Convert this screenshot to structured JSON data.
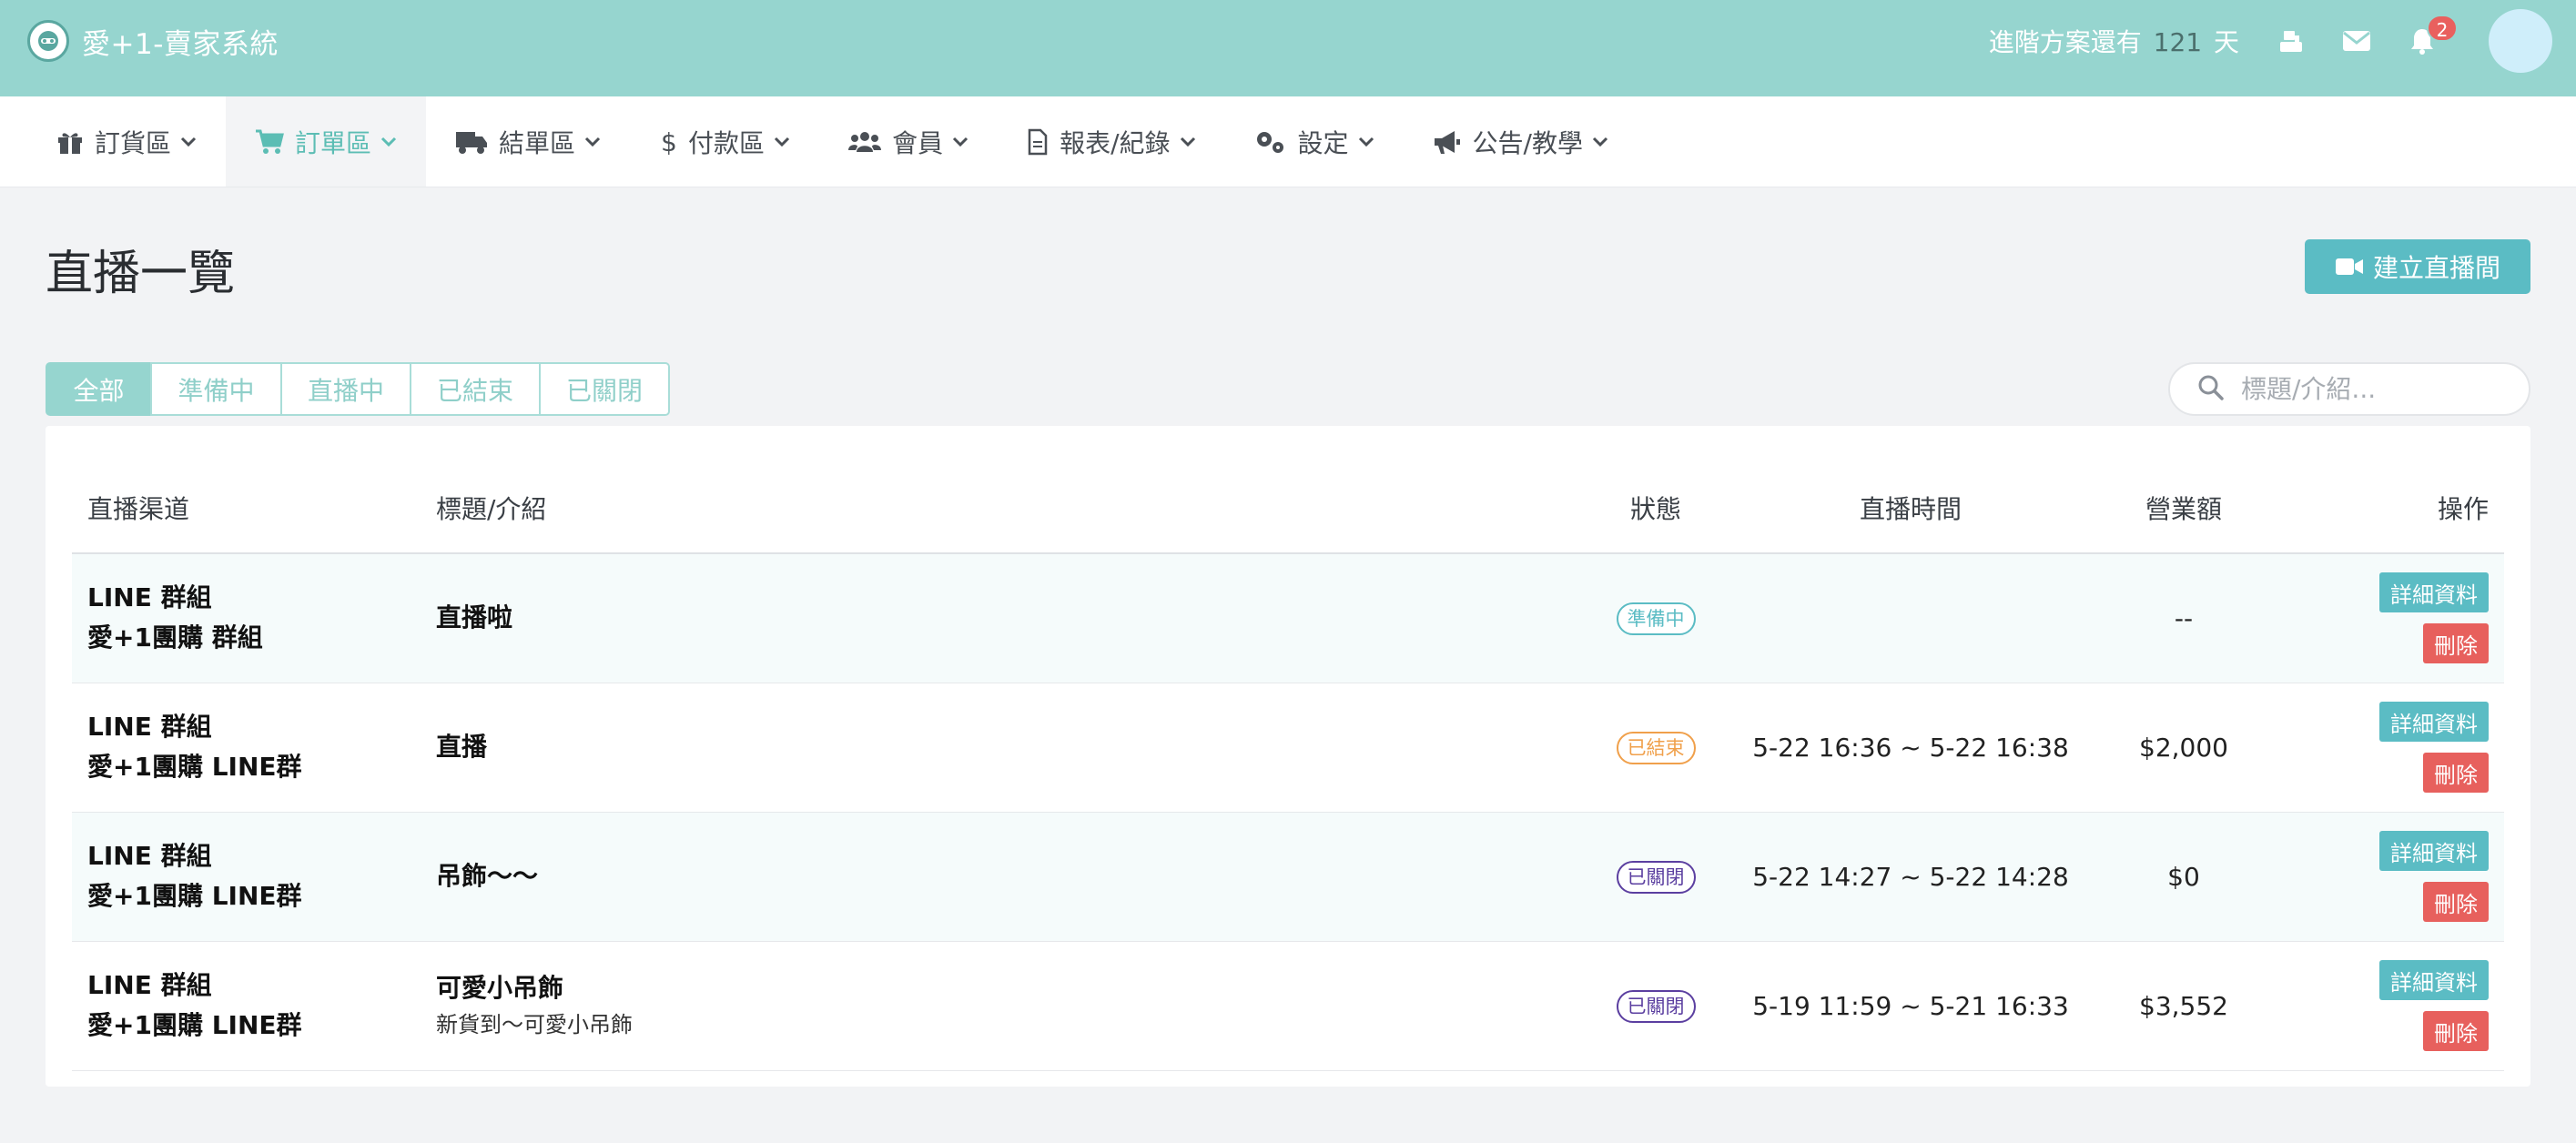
{
  "app": {
    "title": "愛+1-賣家系統",
    "plan_prefix": "進階方案還有",
    "plan_days": "121",
    "plan_suffix": "天",
    "notification_count": "2"
  },
  "nav": {
    "items": [
      {
        "label": "訂貨區",
        "icon": "gift-icon"
      },
      {
        "label": "訂單區",
        "icon": "cart-icon",
        "active": true
      },
      {
        "label": "結單區",
        "icon": "truck-icon"
      },
      {
        "label": "付款區",
        "icon": "dollar-icon"
      },
      {
        "label": "會員",
        "icon": "users-icon"
      },
      {
        "label": "報表/紀錄",
        "icon": "file-icon"
      },
      {
        "label": "設定",
        "icon": "gears-icon"
      },
      {
        "label": "公告/教學",
        "icon": "megaphone-icon"
      }
    ]
  },
  "page": {
    "title": "直播一覽",
    "create_button": "建立直播間"
  },
  "filters": {
    "tabs": [
      "全部",
      "準備中",
      "直播中",
      "已結束",
      "已關閉"
    ],
    "active_index": 0
  },
  "search": {
    "placeholder": "標題/介紹...",
    "value": ""
  },
  "table": {
    "headers": {
      "channel": "直播渠道",
      "title": "標題/介紹",
      "status": "狀態",
      "time": "直播時間",
      "revenue": "營業額",
      "actions": "操作"
    },
    "detail_label": "詳細資料",
    "delete_label": "刪除",
    "rows": [
      {
        "channel_type": "LINE 群組",
        "channel_name": "愛+1團購 群組",
        "title": "直播啦",
        "subtitle": "",
        "status": "準備中",
        "status_kind": "prep",
        "time": "",
        "revenue": "--"
      },
      {
        "channel_type": "LINE 群組",
        "channel_name": "愛+1團購 LINE群",
        "title": "直播",
        "subtitle": "",
        "status": "已結束",
        "status_kind": "ended",
        "time": "5-22 16:36 ~ 5-22 16:38",
        "revenue": "$2,000"
      },
      {
        "channel_type": "LINE 群組",
        "channel_name": "愛+1團購 LINE群",
        "title": "吊飾〜〜",
        "subtitle": "",
        "status": "已關閉",
        "status_kind": "closed",
        "time": "5-22 14:27 ~ 5-22 14:28",
        "revenue": "$0"
      },
      {
        "channel_type": "LINE 群組",
        "channel_name": "愛+1團購 LINE群",
        "title": "可愛小吊飾",
        "subtitle": "新貨到〜可愛小吊飾",
        "status": "已關閉",
        "status_kind": "closed",
        "time": "5-19 11:59 ~ 5-21 16:33",
        "revenue": "$3,552"
      }
    ]
  },
  "colors": {
    "header_bg": "#96d5cf",
    "accent": "#5bbcc4",
    "danger": "#e7605d",
    "status_prep": "#5bbcc4",
    "status_ended": "#f0a04b",
    "status_closed": "#5b3fa0"
  }
}
